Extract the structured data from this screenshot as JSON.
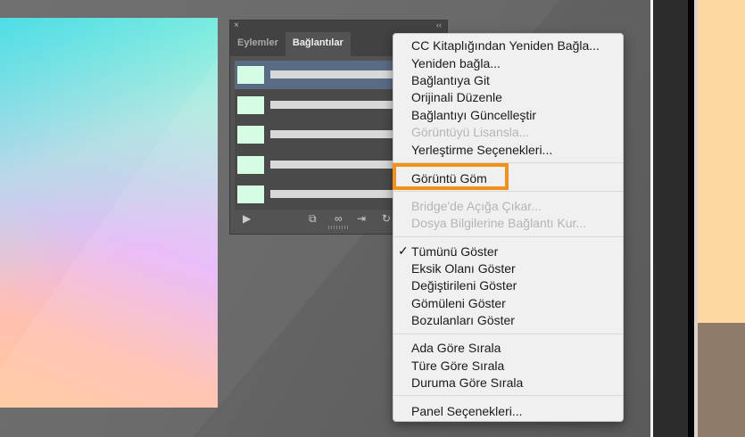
{
  "panel": {
    "tabs": [
      "Eylemler",
      "Bağlantılar"
    ],
    "active_tab": 1,
    "close_glyph": "×",
    "collapse_glyph": "‹‹",
    "link_count": 5
  },
  "menu": {
    "items": [
      {
        "label": "CC Kitaplığından Yeniden Bağla...",
        "enabled": true
      },
      {
        "label": "Yeniden bağla...",
        "enabled": true
      },
      {
        "label": "Bağlantıya Git",
        "enabled": true
      },
      {
        "label": "Orijinali Düzenle",
        "enabled": true
      },
      {
        "label": "Bağlantıyı Güncelleştir",
        "enabled": true
      },
      {
        "label": "Görüntüyü Lisansla...",
        "enabled": false
      },
      {
        "label": "Yerleştirme Seçenekleri...",
        "enabled": true
      },
      {
        "label": "Görüntü Göm",
        "enabled": true,
        "highlighted": true
      },
      {
        "label": "Bridge'de Açığa Çıkar...",
        "enabled": false
      },
      {
        "label": "Dosya Bilgilerine Bağlantı Kur...",
        "enabled": false
      },
      {
        "label": "Tümünü Göster",
        "enabled": true,
        "checked": true
      },
      {
        "label": "Eksik Olanı Göster",
        "enabled": true
      },
      {
        "label": "Değiştirileni Göster",
        "enabled": true
      },
      {
        "label": "Gömüleni Göster",
        "enabled": true
      },
      {
        "label": "Bozulanları Göster",
        "enabled": true
      },
      {
        "label": "Ada Göre Sırala",
        "enabled": true
      },
      {
        "label": "Türe Göre Sırala",
        "enabled": true
      },
      {
        "label": "Duruma Göre Sırala",
        "enabled": true
      },
      {
        "label": "Panel Seçenekleri...",
        "enabled": true
      }
    ],
    "check_glyph": "✓",
    "highlight_color": "#f29118"
  }
}
